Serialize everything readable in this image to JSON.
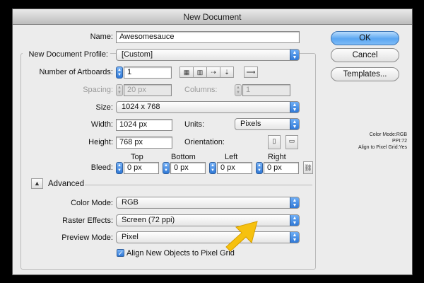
{
  "window": {
    "title": "New Document"
  },
  "name": {
    "label": "Name:",
    "value": "Awesomesauce"
  },
  "profile": {
    "label": "New Document Profile:",
    "value": "[Custom]"
  },
  "artboards": {
    "label": "Number of Artboards:",
    "value": "1"
  },
  "spacing": {
    "label": "Spacing:",
    "value": "20 px"
  },
  "columns": {
    "label": "Columns:",
    "value": "1"
  },
  "size": {
    "label": "Size:",
    "value": "1024 x 768"
  },
  "width": {
    "label": "Width:",
    "value": "1024 px"
  },
  "units": {
    "label": "Units:",
    "value": "Pixels"
  },
  "height": {
    "label": "Height:",
    "value": "768 px"
  },
  "orientation": {
    "label": "Orientation:"
  },
  "bleed": {
    "label": "Bleed:",
    "headers": {
      "top": "Top",
      "bottom": "Bottom",
      "left": "Left",
      "right": "Right"
    },
    "values": {
      "top": "0 px",
      "bottom": "0 px",
      "left": "0 px",
      "right": "0 px"
    }
  },
  "advanced": {
    "label": "Advanced"
  },
  "color_mode": {
    "label": "Color Mode:",
    "value": "RGB"
  },
  "raster_effects": {
    "label": "Raster Effects:",
    "value": "Screen (72 ppi)"
  },
  "preview_mode": {
    "label": "Preview Mode:",
    "value": "Pixel"
  },
  "align_grid": {
    "label": "Align New Objects to Pixel Grid",
    "checked": true
  },
  "buttons": {
    "ok": "OK",
    "cancel": "Cancel",
    "templates": "Templates..."
  },
  "summary": {
    "color_mode": "Color Mode:RGB",
    "ppi": "PPI:72",
    "align": "Align to Pixel Grid:Yes"
  },
  "colors": {
    "accent_blue": "#4a90e2",
    "arrow_yellow": "#f6c10f",
    "background": "#000000"
  }
}
